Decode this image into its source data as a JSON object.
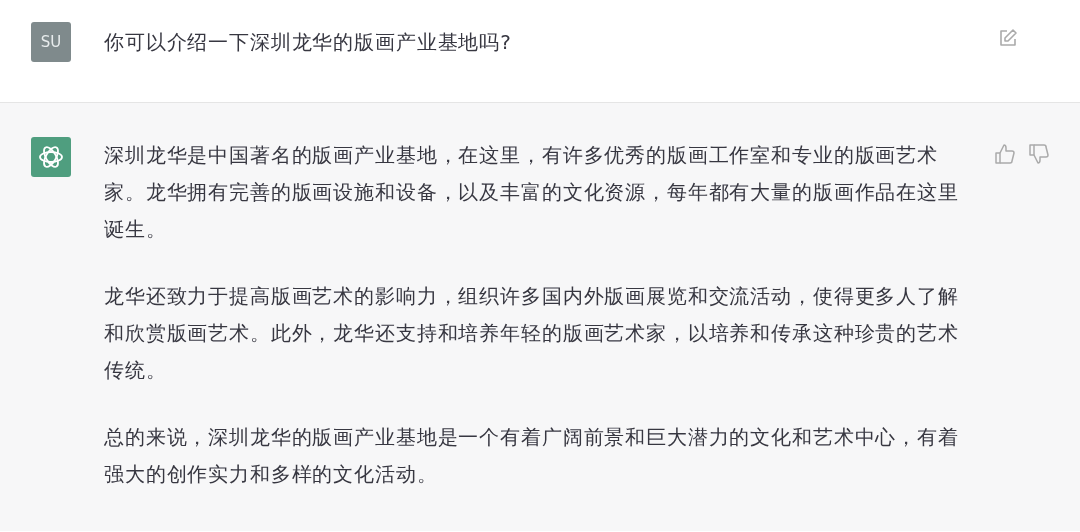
{
  "messages": [
    {
      "kind": "user",
      "avatar": "SU",
      "paragraphs": [
        "你可以介绍一下深圳龙华的版画产业基地吗?"
      ]
    },
    {
      "kind": "assistant",
      "paragraphs": [
        "深圳龙华是中国著名的版画产业基地，在这里，有许多优秀的版画工作室和专业的版画艺术家。龙华拥有完善的版画设施和设备，以及丰富的文化资源，每年都有大量的版画作品在这里诞生。",
        "龙华还致力于提高版画艺术的影响力，组织许多国内外版画展览和交流活动，使得更多人了解和欣赏版画艺术。此外，龙华还支持和培养年轻的版画艺术家，以培养和传承这种珍贵的艺术传统。",
        "总的来说，深圳龙华的版画产业基地是一个有着广阔前景和巨大潜力的文化和艺术中心，有着强大的创作实力和多样的文化活动。"
      ]
    }
  ]
}
